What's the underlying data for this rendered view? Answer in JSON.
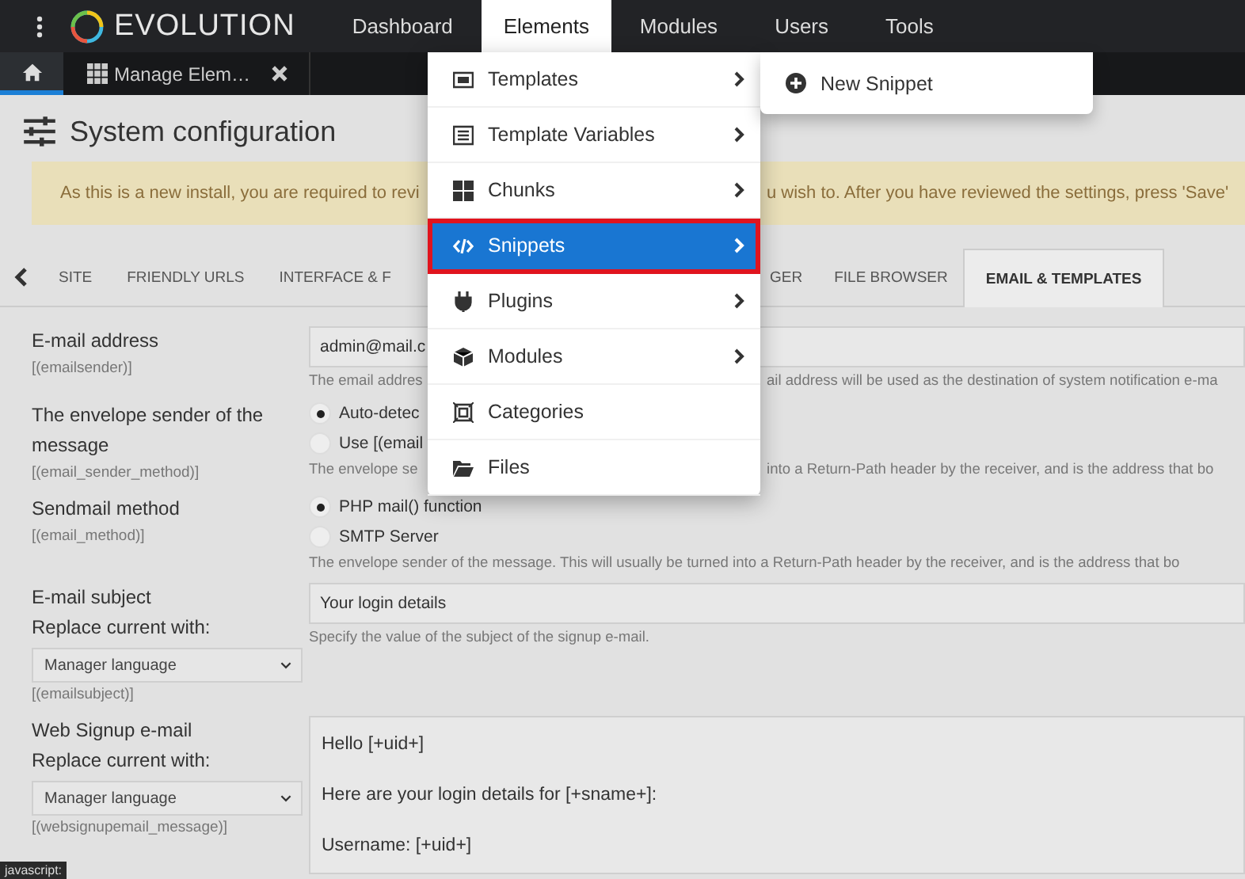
{
  "topbar": {
    "logo": "EVOLUTION",
    "nav": [
      {
        "label": "Dashboard",
        "selected": false
      },
      {
        "label": "Elements",
        "selected": true
      },
      {
        "label": "Modules",
        "selected": false
      },
      {
        "label": "Users",
        "selected": false
      },
      {
        "label": "Tools",
        "selected": false
      }
    ]
  },
  "doc_tabs": [
    {
      "kind": "home",
      "selected": true
    },
    {
      "kind": "page",
      "label": "Manage Elem…",
      "selected": false
    }
  ],
  "page": {
    "title": "System configuration",
    "alert": {
      "text_before_menu": "As this is a new install, you are required to revi",
      "text_after_menu": "u wish to. After you have reviewed the settings, press 'Save'"
    }
  },
  "settings_tabs": {
    "before_menu": [
      {
        "label": "SITE",
        "selected": false
      },
      {
        "label": "FRIENDLY URLS",
        "selected": false
      },
      {
        "label": "INTERFACE & F",
        "selected": false
      }
    ],
    "after_menu": [
      {
        "label": "GER",
        "selected": false
      },
      {
        "label": "FILE BROWSER",
        "selected": false
      },
      {
        "label": "EMAIL & TEMPLATES",
        "selected": true
      }
    ]
  },
  "rows": [
    {
      "kind": "text",
      "label": "E-mail address",
      "key": "[(emailsender)]",
      "value": "admin@mail.c",
      "hint_before_menu": "The email addres",
      "hint_after_menu": "ail address will be used as the destination of system notification e-ma"
    },
    {
      "kind": "radio",
      "label": "The envelope sender of the message",
      "key": "[(email_sender_method)]",
      "options": [
        {
          "label": "Auto-detec",
          "selected": true
        },
        {
          "label": "Use [(email",
          "selected": false
        }
      ],
      "hint_before_menu": "The envelope se",
      "hint_after_menu": "into a Return-Path header by the receiver, and is the address that bo"
    },
    {
      "kind": "radio",
      "label": "Sendmail method",
      "key": "[(email_method)]",
      "options": [
        {
          "label": "PHP mail() function",
          "selected": true
        },
        {
          "label": "SMTP Server",
          "selected": false
        }
      ],
      "hint": "The envelope sender of the message. This will usually be turned into a Return-Path header by the receiver, and is the address that bo"
    },
    {
      "kind": "text",
      "label": "E-mail subject",
      "replace_label": "Replace current with:",
      "select": "Manager language",
      "key": "[(emailsubject)]",
      "value": "Your login details",
      "hint": "Specify the value of the subject of the signup e-mail."
    },
    {
      "kind": "textarea",
      "label": "Web Signup e-mail",
      "replace_label": "Replace current with:",
      "select": "Manager language",
      "key": "[(websignupemail_message)]",
      "lines": [
        "Hello [+uid+]",
        "Here are your login details for [+sname+]:",
        "Username: [+uid+]"
      ]
    }
  ],
  "menu": {
    "items": [
      {
        "label": "Templates",
        "submenu": true,
        "selected": false
      },
      {
        "label": "Template Variables",
        "submenu": true,
        "selected": false
      },
      {
        "label": "Chunks",
        "submenu": true,
        "selected": false
      },
      {
        "label": "Snippets",
        "submenu": true,
        "selected": true
      },
      {
        "label": "Plugins",
        "submenu": true,
        "selected": false
      },
      {
        "label": "Modules",
        "submenu": true,
        "selected": false
      },
      {
        "label": "Categories",
        "submenu": false,
        "selected": false
      },
      {
        "label": "Files",
        "submenu": false,
        "selected": false
      }
    ]
  },
  "submenu": {
    "items": [
      {
        "label": "New Snippet"
      }
    ]
  },
  "status_tip": "javascript:"
}
